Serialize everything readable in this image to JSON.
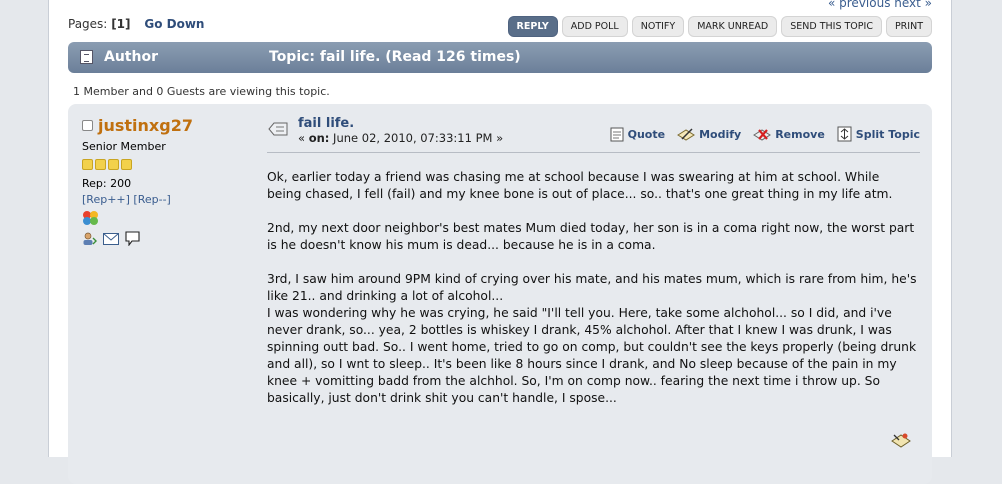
{
  "nav": {
    "prev_next": "« previous next »"
  },
  "pagination": {
    "label": "Pages:",
    "current": "[1]",
    "go_down": "Go Down"
  },
  "buttons": [
    "REPLY",
    "ADD POLL",
    "NOTIFY",
    "MARK UNREAD",
    "SEND THIS TOPIC",
    "PRINT"
  ],
  "header": {
    "author": "Author",
    "topic": "Topic: fail life.  (Read 126 times)"
  },
  "viewers": "1 Member and 0 Guests are viewing this topic.",
  "poster": {
    "name": "justinxg27",
    "group": "Senior Member",
    "stars": 4,
    "rep": "Rep: 200",
    "rep_plus": "[Rep++]",
    "rep_minus": "[Rep--]"
  },
  "post": {
    "title": "fail life.",
    "date_prefix": "«",
    "date_on": "on:",
    "date": "June 02, 2010, 07:33:11 PM »",
    "actions": {
      "quote": "Quote",
      "modify": "Modify",
      "remove": "Remove",
      "split": "Split Topic"
    },
    "paragraphs": [
      "Ok, earlier today a friend was chasing me at school because I was swearing at him at school. While being chased, I fell (fail) and my knee bone is out of place... so.. that's one great thing in my life atm.",
      "2nd, my next door neighbor's best mates Mum died today, her son is in a coma right now, the worst part is he doesn't know his mum is dead... because he is in a coma.",
      "3rd, I saw him around 9PM kind of crying over his mate, and his mates mum, which is rare from him, he's like 21.. and drinking a lot of alcohol...\nI was wondering why he was crying, he said \"I'll tell you. Here, take some alchohol... so I did, and i've never drank, so... yea, 2 bottles is whiskey I drank, 45% alchohol. After that I knew I was drunk, I was spinning outt bad. So.. I went home, tried to go on comp, but couldn't see the keys properly (being drunk and all), so I wnt to sleep.. It's been like 8 hours since I drank, and No sleep because of the pain in my knee + vomitting badd from the alchhol. So, I'm on comp now.. fearing the next time i throw up. So basically, just don't drink shit you can't handle, I spose..."
    ]
  },
  "colors": {
    "accent": "#596e89",
    "username": "#c0700f",
    "link": "#2f4d7a"
  }
}
